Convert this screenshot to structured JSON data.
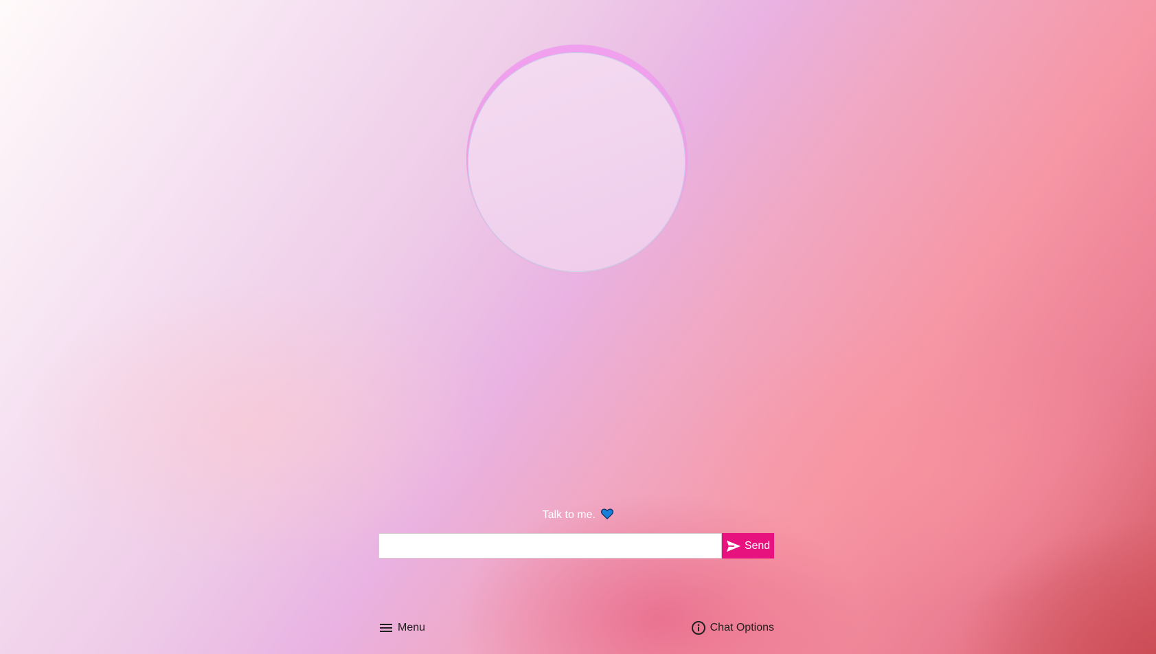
{
  "prompt": {
    "text": "Talk to me.",
    "icon": "blue-heart-icon"
  },
  "composer": {
    "input_value": "",
    "input_placeholder": "",
    "send_label": "Send",
    "send_icon": "paper-plane-icon",
    "send_color": "#e8127e"
  },
  "footer": {
    "menu_label": "Menu",
    "menu_icon": "hamburger-icon",
    "options_label": "Chat Options",
    "options_icon": "info-icon"
  },
  "colors": {
    "accent": "#e8127e",
    "orb_rim": "#f0a0ee",
    "heart": "#1a7fd8"
  }
}
